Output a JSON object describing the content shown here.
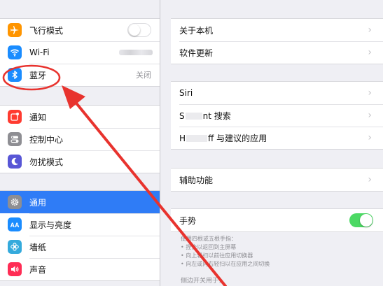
{
  "sidebar": {
    "group1": [
      {
        "label": "飞行模式",
        "icon": "airplane-icon",
        "color": "#ff9500",
        "accessory": "toggle-off"
      },
      {
        "label": "Wi-Fi",
        "icon": "wifi-icon",
        "color": "#1a8cff",
        "accessory": "blurred"
      },
      {
        "label": "蓝牙",
        "icon": "bluetooth-icon",
        "color": "#1a8cff",
        "value": "关闭"
      }
    ],
    "group2": [
      {
        "label": "通知",
        "icon": "notifications-icon",
        "color": "#ff3b30"
      },
      {
        "label": "控制中心",
        "icon": "control-center-icon",
        "color": "#8e8e93"
      },
      {
        "label": "勿扰模式",
        "icon": "moon-icon",
        "color": "#5856d6"
      }
    ],
    "group3": [
      {
        "label": "通用",
        "icon": "gear-icon",
        "color": "#8e8e93",
        "selected": true
      },
      {
        "label": "显示与亮度",
        "icon": "text-size-icon",
        "color": "#1a8cff"
      },
      {
        "label": "墙纸",
        "icon": "flower-icon",
        "color": "#34aadc"
      },
      {
        "label": "声音",
        "icon": "speaker-icon",
        "color": "#ff2d55"
      }
    ]
  },
  "detail": {
    "about": "关于本机",
    "software_update": "软件更新",
    "siri": "Siri",
    "search_a": "S",
    "search_b": "nt 搜索",
    "handoff_a": "H",
    "handoff_b": "ff 与建议的应用",
    "accessibility": "辅助功能",
    "gestures": "手势",
    "gesture_notes": [
      "使用四根或五根手指：",
      "• 捏合以返回到主屏幕",
      "• 向上轻扫以前往应用切换器",
      "• 向左或向右轻扫以在应用之间切换"
    ],
    "side_switch": "侧边开关用于："
  },
  "colors": {
    "selected_row": "#2f7cf6",
    "annotation": "#e8332e",
    "toggle_on": "#4cd964"
  }
}
